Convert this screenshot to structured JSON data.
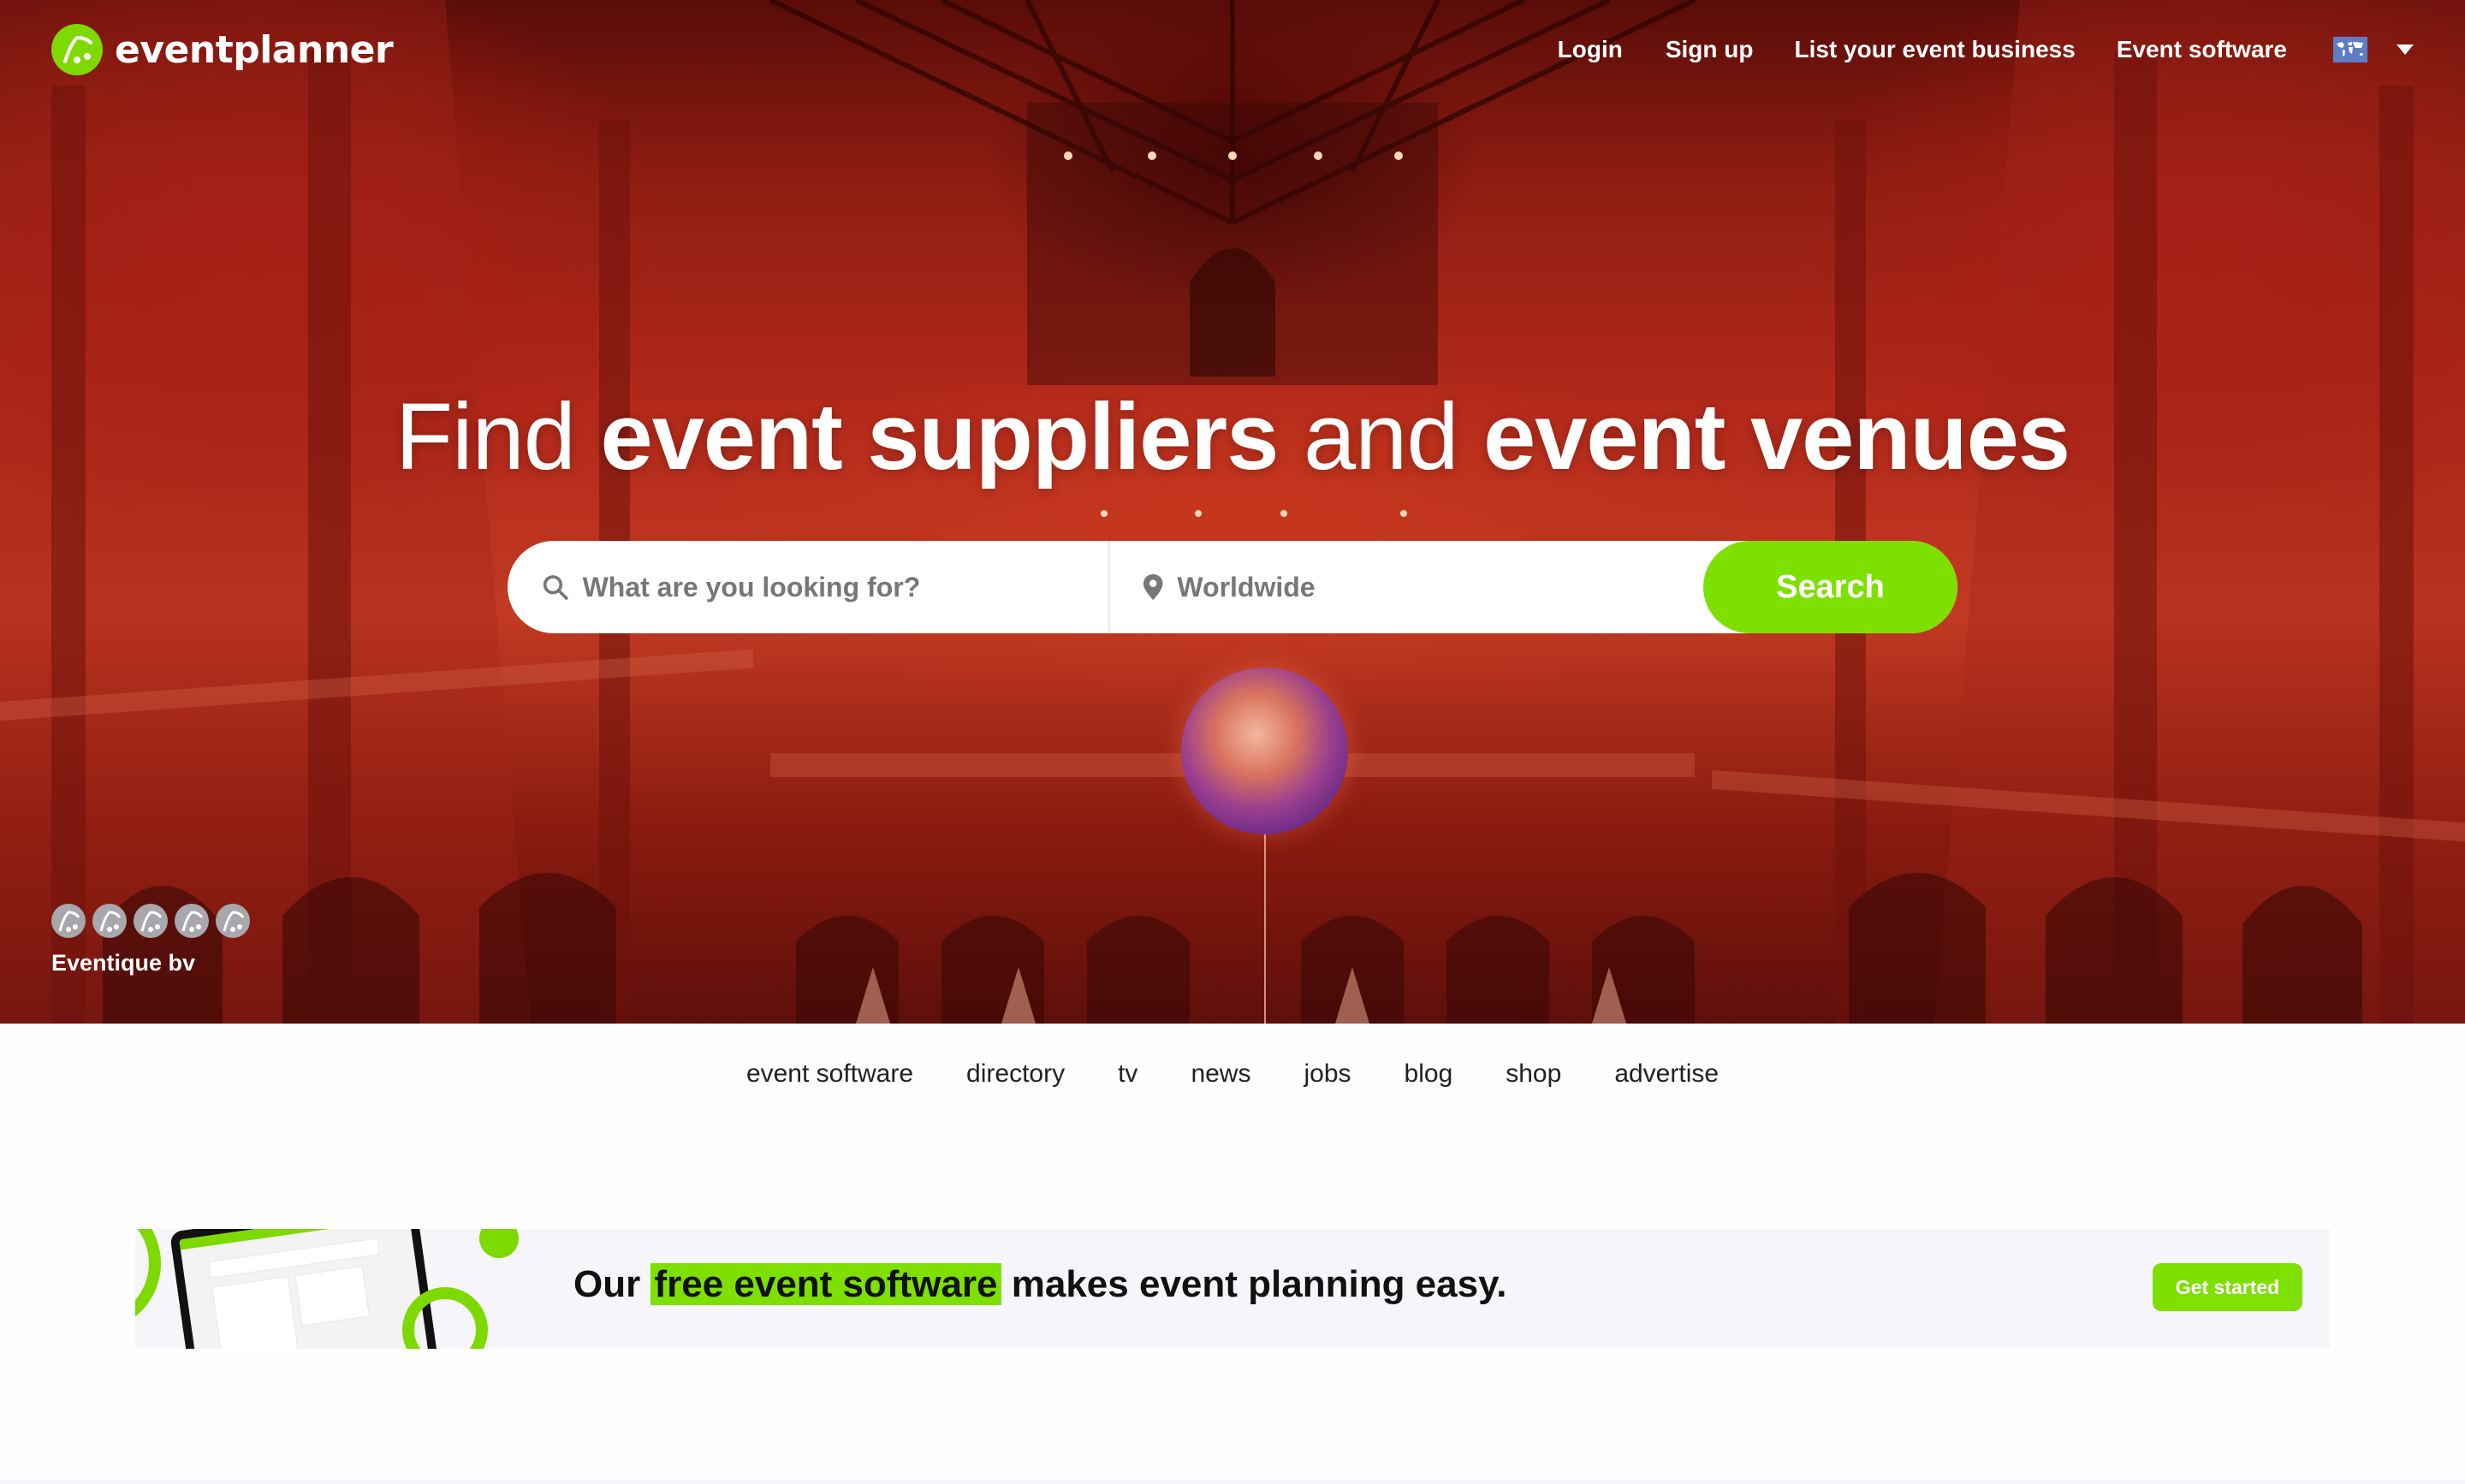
{
  "brand": {
    "name": "eventplanner",
    "accent_color": "#7ee000"
  },
  "topnav": {
    "items": [
      {
        "label": "Login"
      },
      {
        "label": "Sign up"
      },
      {
        "label": "List your event business"
      },
      {
        "label": "Event software"
      }
    ],
    "language_icon": "world-map-flag-icon",
    "dropdown_icon": "caret-down-icon"
  },
  "hero": {
    "headline": {
      "part1": "Find ",
      "part2": "event suppliers",
      "part3": " and ",
      "part4": "event venues"
    },
    "search": {
      "what_placeholder": "What are you looking for?",
      "what_value": "",
      "where_placeholder": "Worldwide",
      "where_value": "",
      "button_label": "Search"
    },
    "credit": {
      "avatar_count": 5,
      "label": "Eventique bv"
    }
  },
  "subnav": {
    "items": [
      {
        "label": "event software"
      },
      {
        "label": "directory"
      },
      {
        "label": "tv"
      },
      {
        "label": "news"
      },
      {
        "label": "jobs"
      },
      {
        "label": "blog"
      },
      {
        "label": "shop"
      },
      {
        "label": "advertise"
      }
    ]
  },
  "banner": {
    "text_before": "Our ",
    "highlight": "free event software",
    "text_after": " makes event planning easy.",
    "button_label": "Get started"
  }
}
